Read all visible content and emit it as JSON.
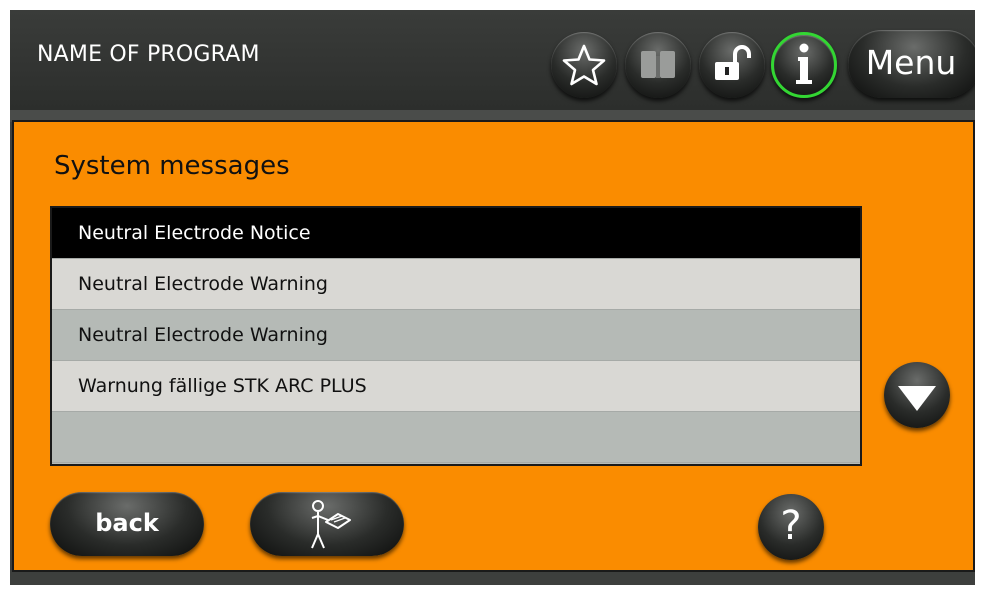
{
  "header": {
    "program_name": "NAME OF PROGRAM",
    "menu_label": "Menu",
    "icons": [
      "star-icon",
      "book-icon",
      "unlock-icon",
      "info-icon"
    ],
    "info_active_color": "#33d633"
  },
  "panel": {
    "title": "System messages",
    "background_color": "#fa8c00",
    "messages": [
      {
        "label": "Neutral Electrode Notice",
        "selected": true
      },
      {
        "label": "Neutral Electrode Warning",
        "selected": false
      },
      {
        "label": "Neutral Electrode Warning",
        "selected": false
      },
      {
        "label": "Warnung fällige STK ARC PLUS",
        "selected": false
      },
      {
        "label": "",
        "selected": false
      }
    ]
  },
  "footer": {
    "back_label": "back",
    "help_label": "?",
    "manual_icon": "operating-manual-icon",
    "scroll_icon": "arrow-down-icon"
  }
}
